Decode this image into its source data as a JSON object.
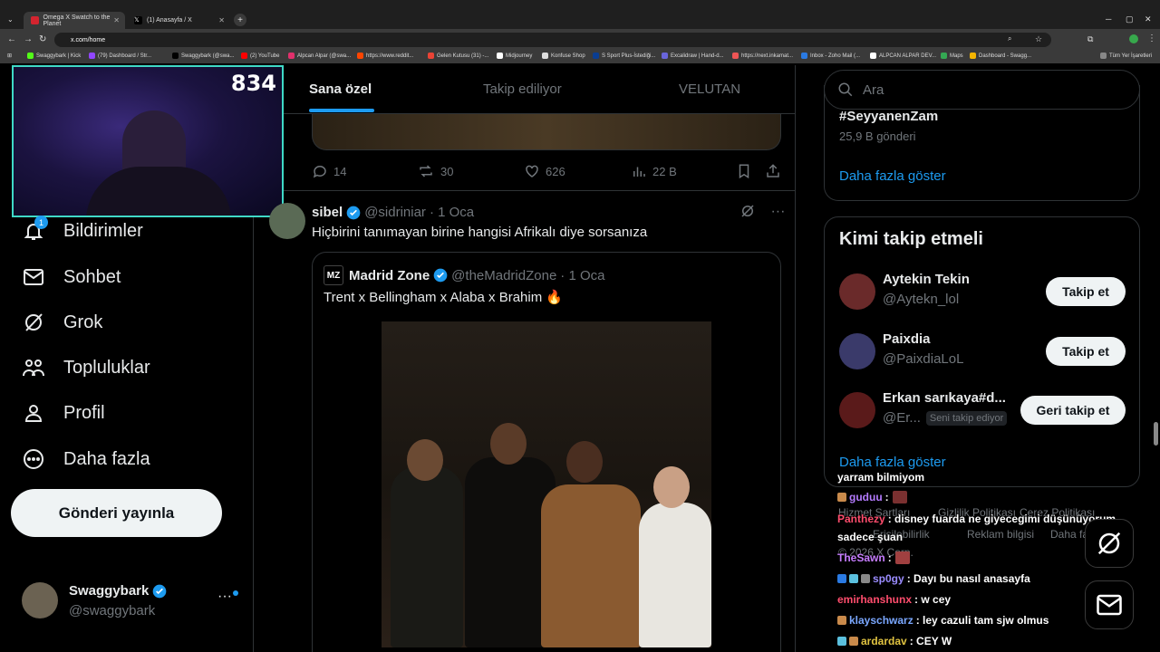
{
  "browser": {
    "tabs": [
      {
        "title": "Omega X Swatch to the Planet",
        "active": true
      },
      {
        "title": "(1) Anasayfa / X",
        "active": false
      }
    ],
    "url": "x.com/home",
    "bookmarks": [
      "Swaggybark | Kick",
      "(79) Dashboard / Str...",
      "Swaggybark (@swa...",
      "(2) YouTube",
      "Alpcan Alpar (@swa...",
      "https://www.reddit...",
      "Gelen Kutusu (31) -...",
      "Midjourney",
      "Konfuse Shop",
      "S Sport Plus-İstediği...",
      "Excalidraw | Hand-d...",
      "https://next.inkamat...",
      "Inbox - Zoho Mail (...",
      "ALPCAN ALPAR DEV...",
      "Maps",
      "Dashboard - Swagg...",
      "Tüm Yer İşaretleri"
    ]
  },
  "webcam": {
    "viewer_count": "834"
  },
  "left_nav": {
    "notif_badge": "1",
    "items": [
      {
        "label": "Bildirimler",
        "icon": "bell-icon"
      },
      {
        "label": "Sohbet",
        "icon": "mail-icon"
      },
      {
        "label": "Grok",
        "icon": "grok-icon"
      },
      {
        "label": "Topluluklar",
        "icon": "communities-icon"
      },
      {
        "label": "Profil",
        "icon": "profile-icon"
      },
      {
        "label": "Daha fazla",
        "icon": "more-icon"
      }
    ],
    "post_button": "Gönderi yayınla",
    "account": {
      "name": "Swaggybark",
      "handle": "@swaggybark"
    }
  },
  "feed": {
    "tabs": [
      "Sana özel",
      "Takip ediliyor",
      "VELUTAN"
    ],
    "prev_actions": {
      "replies": "14",
      "reposts": "30",
      "likes": "626",
      "views": "22 B"
    },
    "tweet": {
      "name": "sibel",
      "handle": "@sidriniar",
      "time": "· 1 Oca",
      "text": "Hiçbirini tanımayan birine hangisi Afrikalı diye sorsanıza",
      "quote": {
        "avatar_text": "MZ",
        "name": "Madrid Zone",
        "handle": "@theMadridZone",
        "time": "· 1 Oca",
        "text": "Trent x Bellingham x Alaba x Brahim 🔥"
      }
    }
  },
  "right": {
    "search_placeholder": "Ara",
    "trend": {
      "title": "#SeyyanenZam",
      "count": "25,9 B gönderi",
      "more": "Daha fazla göster"
    },
    "who_to_follow": {
      "title": "Kimi takip etmeli",
      "users": [
        {
          "name": "Aytekin Tekin",
          "handle": "@Aytekn_lol",
          "button": "Takip et",
          "follows_you": ""
        },
        {
          "name": "Paixdia",
          "handle": "@PaixdiaLoL",
          "button": "Takip et",
          "follows_you": ""
        },
        {
          "name": "Erkan sarıkaya#d...",
          "handle": "@Er...",
          "button": "Geri takip et",
          "follows_you": "Seni takip ediyor"
        }
      ],
      "more": "Daha fazla göster"
    },
    "footer": [
      "Hizmet Şartları",
      "Gizlilik Politikası",
      "Çerez Politikası",
      "Erişilebilirlik",
      "Reklam bilgisi",
      "Daha fa",
      "© 2026 X Corp."
    ]
  },
  "chat": [
    {
      "user": "",
      "text": "yarram bilmiyom",
      "color": "#ffffff"
    },
    {
      "user": "guduu",
      "text": ":",
      "color": "#b57bff"
    },
    {
      "user": "Panthezy",
      "text": ": disney fuarda ne giyecegimi düşünüyorum",
      "color": "#ff4d6d"
    },
    {
      "user": "",
      "text": "sadece şuan",
      "color": "#ffffff"
    },
    {
      "user": "TheSawn",
      "text": ":",
      "color": "#c77dff"
    },
    {
      "user": "sp0gy",
      "text": ": Dayı bu nasıl anasayfa",
      "color": "#9b8cff"
    },
    {
      "user": "emirhanshunx",
      "text": ": w cey",
      "color": "#ff4d6d"
    },
    {
      "user": "klayschwarz",
      "text": ": ley cazuli tam sjw olmus",
      "color": "#7aa7ff"
    },
    {
      "user": "ardardav",
      "text": ": CEY W",
      "color": "#e0c341"
    }
  ]
}
